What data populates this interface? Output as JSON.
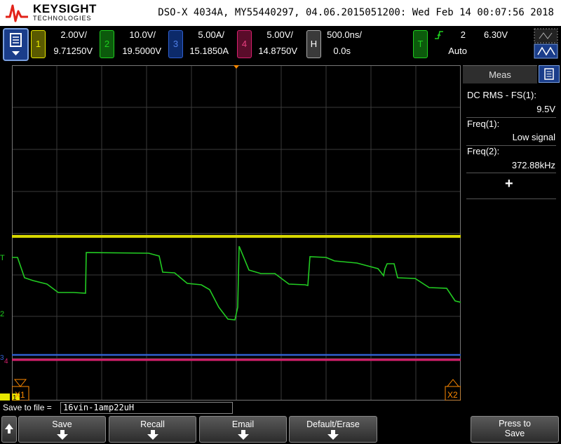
{
  "brand": {
    "line1": "KEYSIGHT",
    "line2": "TECHNOLOGIES"
  },
  "title_info": "DSO-X 4034A, MY55440297, 04.06.2015051200: Wed Feb 14 00:07:56 2018",
  "channels": [
    {
      "num": "1",
      "scale": "2.00V/",
      "offset": "9.71250V",
      "color": "#e8e800"
    },
    {
      "num": "2",
      "scale": "10.0V/",
      "offset": "19.5000V",
      "color": "#1fce1f"
    },
    {
      "num": "3",
      "scale": "5.00A/",
      "offset": "15.1850A",
      "color": "#3060d0"
    },
    {
      "num": "4",
      "scale": "5.00V/",
      "offset": "14.8750V",
      "color": "#d8206e"
    }
  ],
  "horizontal": {
    "label": "H",
    "scale": "500.0ns/",
    "delay": "0.0s"
  },
  "trigger": {
    "label": "T",
    "source": "2",
    "level": "6.30V",
    "mode": "Auto"
  },
  "meas": {
    "tab": "Meas",
    "items": [
      {
        "name": "DC RMS - FS(1):",
        "value": "9.5V"
      },
      {
        "name": "Freq(1):",
        "value": "Low signal"
      },
      {
        "name": "Freq(2):",
        "value": "372.88kHz"
      }
    ],
    "add": "+"
  },
  "markers": {
    "x1": "X1",
    "x2": "X2",
    "ch1": "1",
    "ch2": "2",
    "ch3": "3",
    "ch4": "4",
    "trig": "T"
  },
  "save": {
    "label": "Save to file =",
    "filename": "16vin-1amp22uH"
  },
  "softkeys": [
    {
      "label": "Save"
    },
    {
      "label": "Recall"
    },
    {
      "label": "Email"
    },
    {
      "label": "Default/Erase"
    }
  ],
  "press_to_save": {
    "line1": "Press to",
    "line2": "Save"
  }
}
